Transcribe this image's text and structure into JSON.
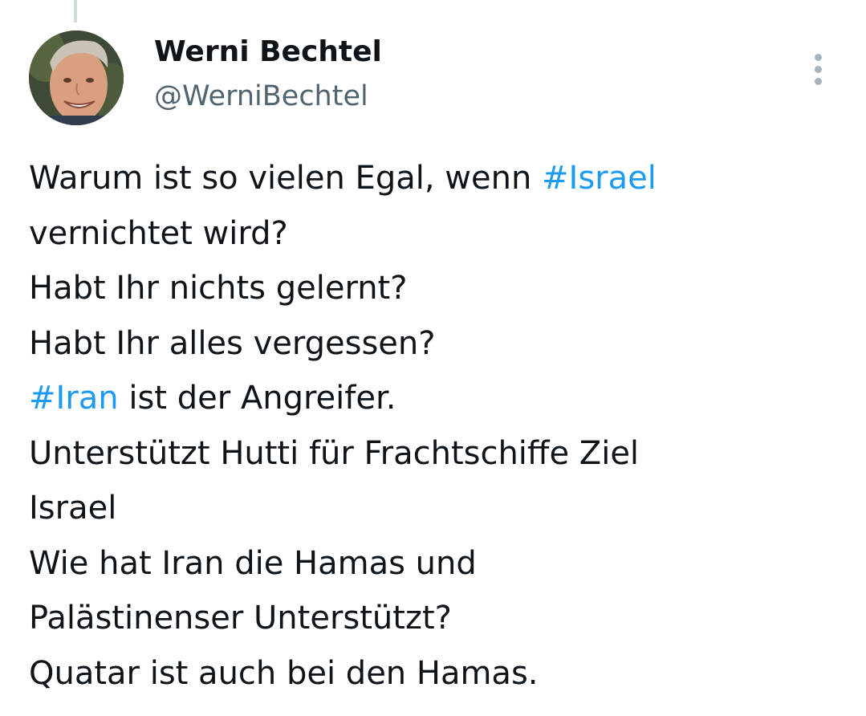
{
  "tweet": {
    "author": {
      "display_name": "Werni Bechtel",
      "handle": "@WerniBechtel"
    },
    "more_icon": "more-vertical-icon",
    "text_lines": [
      {
        "before": "Warum ist so vielen Egal, wenn ",
        "hashtag": "#Israel",
        "after": ""
      },
      {
        "before": "vernichtet wird?",
        "hashtag": "",
        "after": ""
      },
      {
        "before": "Habt Ihr nichts gelernt?",
        "hashtag": "",
        "after": ""
      },
      {
        "before": "Habt Ihr alles vergessen?",
        "hashtag": "",
        "after": ""
      },
      {
        "before": "",
        "hashtag": "#Iran",
        "after": " ist der Angreifer."
      },
      {
        "before": "Unterstützt Hutti für Frachtschiffe Ziel",
        "hashtag": "",
        "after": ""
      },
      {
        "before": "Israel",
        "hashtag": "",
        "after": ""
      },
      {
        "before": "Wie hat Iran die Hamas und",
        "hashtag": "",
        "after": ""
      },
      {
        "before": "Palästinenser Unterstützt?",
        "hashtag": "",
        "after": ""
      },
      {
        "before": "Quatar ist auch bei den Hamas.",
        "hashtag": "",
        "after": ""
      }
    ]
  },
  "colors": {
    "text": "#0f1419",
    "secondary_text": "#536471",
    "hashtag": "#1d9bf0",
    "thread_line": "#cfd9de"
  }
}
